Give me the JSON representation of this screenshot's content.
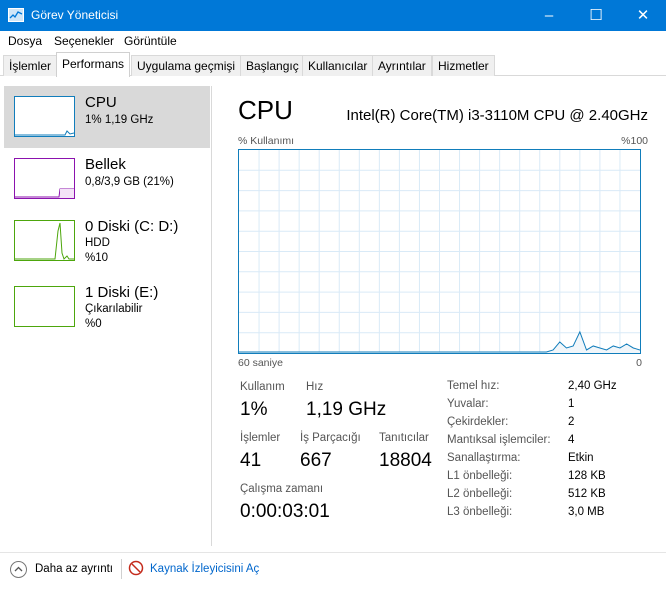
{
  "window": {
    "title": "Görev Yöneticisi",
    "minimize_label": "–",
    "maximize_label": "☐",
    "close_label": "✕"
  },
  "menu": [
    "Dosya",
    "Seçenekler",
    "Görüntüle"
  ],
  "tabs": [
    {
      "label": "İşlemler",
      "active": false
    },
    {
      "label": "Performans",
      "active": true
    },
    {
      "label": "Uygulama geçmişi",
      "active": false
    },
    {
      "label": "Başlangıç",
      "active": false
    },
    {
      "label": "Kullanıcılar",
      "active": false
    },
    {
      "label": "Ayrıntılar",
      "active": false
    },
    {
      "label": "Hizmetler",
      "active": false
    }
  ],
  "sidebar": {
    "items": [
      {
        "name": "CPU",
        "line1": "1% 1,19 GHz",
        "line2": "",
        "color": "#117dbb",
        "selected": true
      },
      {
        "name": "Bellek",
        "line1": "0,8/3,9 GB (21%)",
        "line2": "",
        "color": "#8b12ae",
        "selected": false
      },
      {
        "name": "0 Diski (C: D:)",
        "line1": "HDD",
        "line2": "%10",
        "color": "#4da60c",
        "selected": false
      },
      {
        "name": "1 Diski (E:)",
        "line1": "Çıkarılabilir",
        "line2": "%0",
        "color": "#4da60c",
        "selected": false
      }
    ]
  },
  "main": {
    "title": "CPU",
    "model": "Intel(R) Core(TM) i3-3110M CPU @ 2.40GHz",
    "graph": {
      "top_left": "% Kullanımı",
      "top_right": "%100",
      "bottom_left": "60 saniye",
      "bottom_right": "0",
      "line_color": "#117dbb",
      "usage_percent": [
        0,
        0,
        0,
        0,
        0,
        0,
        0,
        0,
        0,
        0,
        0,
        0,
        0,
        0,
        0,
        0,
        0,
        0,
        0,
        0,
        0,
        0,
        0,
        0,
        0,
        0,
        0,
        0,
        0,
        0,
        0,
        0,
        0,
        0,
        0,
        0,
        0,
        0,
        0,
        0,
        0,
        0,
        0,
        0,
        0,
        0,
        0,
        1,
        5,
        2,
        3,
        10,
        1,
        3,
        2,
        1,
        3,
        2,
        4,
        2,
        1
      ]
    },
    "stats": {
      "utilization_label": "Kullanım",
      "utilization_value": "1%",
      "speed_label": "Hız",
      "speed_value": "1,19 GHz",
      "processes_label": "İşlemler",
      "processes_value": "41",
      "threads_label": "İş Parçacığı",
      "threads_value": "667",
      "handles_label": "Tanıtıcılar",
      "handles_value": "18804",
      "uptime_label": "Çalışma zamanı",
      "uptime_value": "0:00:03:01"
    },
    "specs": [
      {
        "label": "Temel hız:",
        "value": "2,40 GHz"
      },
      {
        "label": "Yuvalar:",
        "value": "1"
      },
      {
        "label": "Çekirdekler:",
        "value": "2"
      },
      {
        "label": "Mantıksal işlemciler:",
        "value": "4"
      },
      {
        "label": "Sanallaştırma:",
        "value": "Etkin"
      },
      {
        "label": "L1 önbelleği:",
        "value": "128 KB"
      },
      {
        "label": "L2 önbelleği:",
        "value": "512 KB"
      },
      {
        "label": "L3 önbelleği:",
        "value": "3,0 MB"
      }
    ]
  },
  "footer": {
    "fewer_details": "Daha az ayrıntı",
    "resource_monitor": "Kaynak İzleyicisini Aç"
  }
}
